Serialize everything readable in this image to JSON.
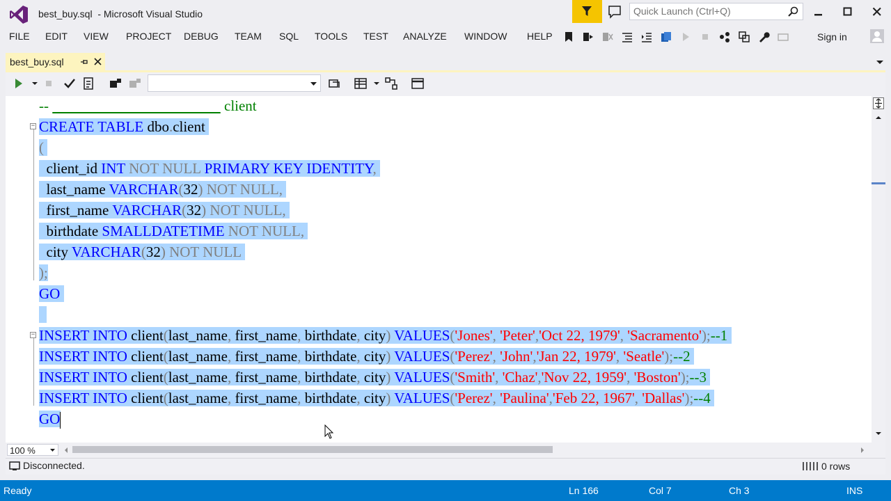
{
  "window": {
    "title": "best_buy.sql  - Microsoft Visual Studio"
  },
  "quick_launch": {
    "placeholder": "Quick Launch (Ctrl+Q)"
  },
  "menu": [
    "FILE",
    "EDIT",
    "VIEW",
    "PROJECT",
    "DEBUG",
    "TEAM",
    "SQL",
    "TOOLS",
    "TEST",
    "ANALYZE",
    "WINDOW",
    "HELP"
  ],
  "signin_label": "Sign in",
  "tab": {
    "label": "best_buy.sql"
  },
  "editor": {
    "lines": [
      {
        "selected": false,
        "fold": null,
        "tokens": [
          [
            "cmt",
            "-- "
          ],
          [
            "cmt-u",
            "                                              "
          ],
          [
            "cmt",
            " client"
          ]
        ]
      },
      {
        "selected": true,
        "fold": "start",
        "tokens": [
          [
            "kw",
            "CREATE TABLE "
          ],
          [
            "txt",
            "dbo"
          ],
          [
            "gray",
            "."
          ],
          [
            "txt",
            "client "
          ]
        ]
      },
      {
        "selected": true,
        "fold": "mid",
        "tokens": [
          [
            "gray",
            "( "
          ]
        ]
      },
      {
        "selected": true,
        "fold": "mid",
        "tokens": [
          [
            "txt",
            "  client_id "
          ],
          [
            "kw",
            "INT "
          ],
          [
            "gray",
            "NOT NULL "
          ],
          [
            "kw",
            "PRIMARY KEY IDENTITY"
          ],
          [
            "gray",
            ", "
          ]
        ]
      },
      {
        "selected": true,
        "fold": "mid",
        "tokens": [
          [
            "txt",
            "  last_name "
          ],
          [
            "kw",
            "VARCHAR"
          ],
          [
            "gray",
            "("
          ],
          [
            "txt",
            "32"
          ],
          [
            "gray",
            ") NOT NULL, "
          ]
        ]
      },
      {
        "selected": true,
        "fold": "mid",
        "tokens": [
          [
            "txt",
            "  first_name "
          ],
          [
            "kw",
            "VARCHAR"
          ],
          [
            "gray",
            "("
          ],
          [
            "txt",
            "32"
          ],
          [
            "gray",
            ") NOT NULL, "
          ]
        ]
      },
      {
        "selected": true,
        "fold": "mid",
        "tokens": [
          [
            "txt",
            "  birthdate "
          ],
          [
            "kw",
            "SMALLDATETIME "
          ],
          [
            "gray",
            "NOT NULL, "
          ]
        ]
      },
      {
        "selected": true,
        "fold": "mid",
        "tokens": [
          [
            "txt",
            "  city "
          ],
          [
            "kw",
            "VARCHAR"
          ],
          [
            "gray",
            "("
          ],
          [
            "txt",
            "32"
          ],
          [
            "gray",
            ") NOT NULL "
          ]
        ]
      },
      {
        "selected": true,
        "fold": "end",
        "tokens": [
          [
            "gray",
            ");"
          ]
        ]
      },
      {
        "selected": true,
        "fold": null,
        "tokens": [
          [
            "kw",
            "GO "
          ]
        ]
      },
      {
        "selected": true,
        "fold": null,
        "tokens": [
          [
            "txt",
            "  "
          ]
        ]
      },
      {
        "selected": true,
        "fold": "start",
        "tokens": [
          [
            "kw",
            "INSERT INTO "
          ],
          [
            "txt",
            "client"
          ],
          [
            "gray",
            "("
          ],
          [
            "txt",
            "last_name"
          ],
          [
            "gray",
            ", "
          ],
          [
            "txt",
            "first_name"
          ],
          [
            "gray",
            ", "
          ],
          [
            "txt",
            "birthdate"
          ],
          [
            "gray",
            ", "
          ],
          [
            "txt",
            "city"
          ],
          [
            "gray",
            ") "
          ],
          [
            "kw",
            "VALUES"
          ],
          [
            "gray",
            "("
          ],
          [
            "str",
            "'Jones'"
          ],
          [
            "gray",
            ", "
          ],
          [
            "str",
            "'Peter'"
          ],
          [
            "gray",
            ","
          ],
          [
            "str",
            "'Oct 22, 1979'"
          ],
          [
            "gray",
            ", "
          ],
          [
            "str",
            "'Sacramento'"
          ],
          [
            "gray",
            ");"
          ],
          [
            "cmt",
            "--1 "
          ]
        ]
      },
      {
        "selected": true,
        "fold": "mid",
        "tokens": [
          [
            "kw",
            "INSERT INTO "
          ],
          [
            "txt",
            "client"
          ],
          [
            "gray",
            "("
          ],
          [
            "txt",
            "last_name"
          ],
          [
            "gray",
            ", "
          ],
          [
            "txt",
            "first_name"
          ],
          [
            "gray",
            ", "
          ],
          [
            "txt",
            "birthdate"
          ],
          [
            "gray",
            ", "
          ],
          [
            "txt",
            "city"
          ],
          [
            "gray",
            ") "
          ],
          [
            "kw",
            "VALUES"
          ],
          [
            "gray",
            "("
          ],
          [
            "str",
            "'Perez'"
          ],
          [
            "gray",
            ", "
          ],
          [
            "str",
            "'John'"
          ],
          [
            "gray",
            ","
          ],
          [
            "str",
            "'Jan 22, 1979'"
          ],
          [
            "gray",
            ", "
          ],
          [
            "str",
            "'Seatle'"
          ],
          [
            "gray",
            ");"
          ],
          [
            "cmt",
            "--2 "
          ]
        ]
      },
      {
        "selected": true,
        "fold": "mid",
        "tokens": [
          [
            "kw",
            "INSERT INTO "
          ],
          [
            "txt",
            "client"
          ],
          [
            "gray",
            "("
          ],
          [
            "txt",
            "last_name"
          ],
          [
            "gray",
            ", "
          ],
          [
            "txt",
            "first_name"
          ],
          [
            "gray",
            ", "
          ],
          [
            "txt",
            "birthdate"
          ],
          [
            "gray",
            ", "
          ],
          [
            "txt",
            "city"
          ],
          [
            "gray",
            ") "
          ],
          [
            "kw",
            "VALUES"
          ],
          [
            "gray",
            "("
          ],
          [
            "str",
            "'Smith'"
          ],
          [
            "gray",
            ", "
          ],
          [
            "str",
            "'Chaz'"
          ],
          [
            "gray",
            ","
          ],
          [
            "str",
            "'Nov 22, 1959'"
          ],
          [
            "gray",
            ", "
          ],
          [
            "str",
            "'Boston'"
          ],
          [
            "gray",
            ");"
          ],
          [
            "cmt",
            "--3 "
          ]
        ]
      },
      {
        "selected": true,
        "fold": "end",
        "tokens": [
          [
            "kw",
            "INSERT INTO "
          ],
          [
            "txt",
            "client"
          ],
          [
            "gray",
            "("
          ],
          [
            "txt",
            "last_name"
          ],
          [
            "gray",
            ", "
          ],
          [
            "txt",
            "first_name"
          ],
          [
            "gray",
            ", "
          ],
          [
            "txt",
            "birthdate"
          ],
          [
            "gray",
            ", "
          ],
          [
            "txt",
            "city"
          ],
          [
            "gray",
            ") "
          ],
          [
            "kw",
            "VALUES"
          ],
          [
            "gray",
            "("
          ],
          [
            "str",
            "'Perez'"
          ],
          [
            "gray",
            ", "
          ],
          [
            "str",
            "'Paulina'"
          ],
          [
            "gray",
            ","
          ],
          [
            "str",
            "'Feb 22, 1967'"
          ],
          [
            "gray",
            ", "
          ],
          [
            "str",
            "'Dallas'"
          ],
          [
            "gray",
            ");"
          ],
          [
            "cmt",
            "--4 "
          ]
        ]
      },
      {
        "selected": true,
        "fold": null,
        "caret": true,
        "tokens": [
          [
            "kw",
            "GO"
          ]
        ]
      }
    ]
  },
  "zoom": "100 %",
  "query_status": {
    "connection": "Disconnected.",
    "rows": "0 rows"
  },
  "status": {
    "ready": "Ready",
    "ln": "Ln 166",
    "col": "Col 7",
    "ch": "Ch 3",
    "ins": "INS"
  },
  "colors": {
    "accent": "#007acc",
    "selection": "#add6ff",
    "keyword": "#0000ff",
    "string": "#ff0000",
    "comment": "#008000",
    "tab_active": "#fdf4bf",
    "filter": "#f5c400"
  }
}
